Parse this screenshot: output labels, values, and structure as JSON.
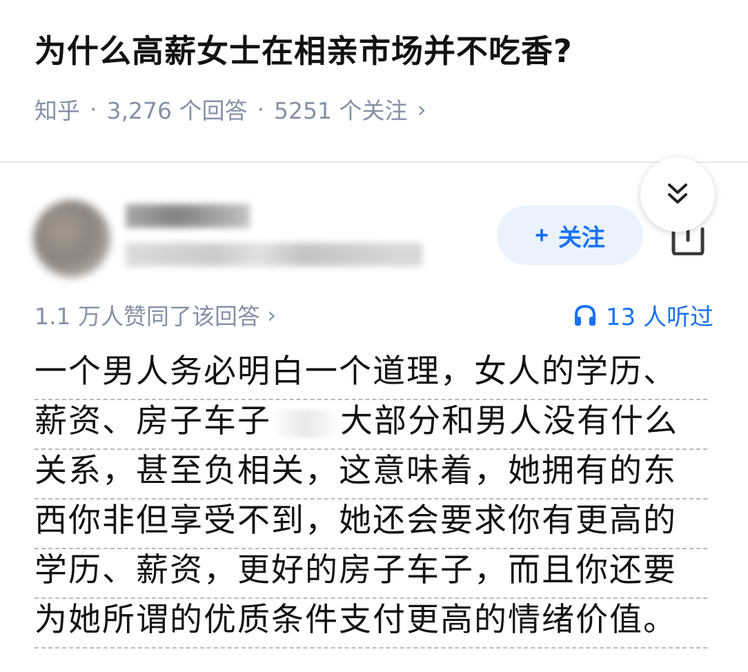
{
  "question": {
    "title": "为什么高薪女士在相亲市场并不吃香?",
    "source": "知乎",
    "separator": "·",
    "answers_count": "3,276 个回答",
    "followers_count": "5251 个关注",
    "chevron": "›"
  },
  "author": {
    "follow_plus": "+",
    "follow_label": "关注"
  },
  "stats": {
    "votes_text": "1.1 万人赞同了该回答",
    "votes_chevron": "›",
    "listen_text": "13 人听过"
  },
  "answer": {
    "lines": [
      "一个男人务必明白一个道理，女人的学历、",
      "薪资、房子车子",
      "大部分和男人没有什么",
      "关系，甚至负相关，这意味着，她拥有的东",
      "西你非但享受不到，她还会要求你有更高的",
      "学历、薪资，更好的房子车子，而且你还要",
      "为她所谓的优质条件支付更高的情绪价值。"
    ]
  },
  "colors": {
    "accent": "#1772f6",
    "muted": "#8590a6",
    "text": "#121212",
    "follow_bg": "#eaf2fd"
  },
  "icons": {
    "collapse": "double-chevron-down-icon",
    "share": "share-icon",
    "headphones": "headphones-icon"
  }
}
